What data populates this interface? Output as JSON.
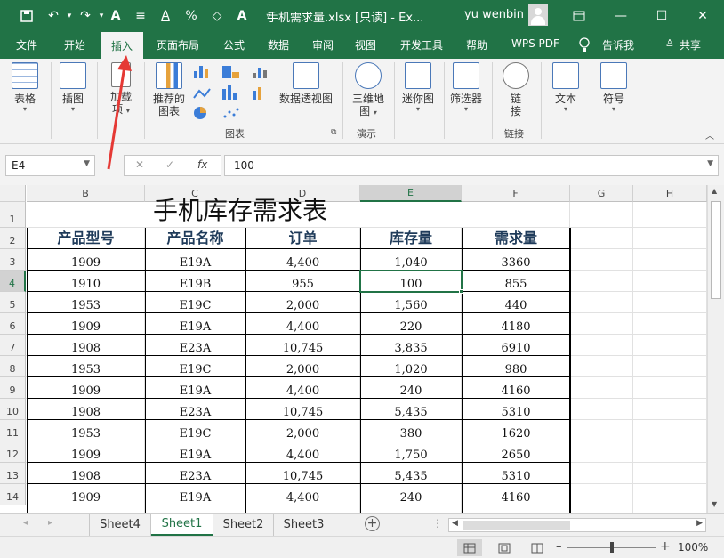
{
  "titlebar": {
    "doc_title": "手机需求量.xlsx [只读] - Ex...",
    "user_name": "yu wenbin"
  },
  "tabs": [
    "文件",
    "开始",
    "插入",
    "页面布局",
    "公式",
    "数据",
    "审阅",
    "视图",
    "开发工具",
    "帮助",
    "WPS PDF",
    "告诉我",
    "共享"
  ],
  "ribbon": {
    "table": "表格",
    "illustrations": "插图",
    "addins_1": "加载",
    "addins_2": "项",
    "recommended_1": "推荐的",
    "recommended_2": "图表",
    "pivot_chart": "数据透视图",
    "map_1": "三维地",
    "map_2": "图",
    "sparkline": "迷你图",
    "filter": "筛选器",
    "link_1": "链",
    "link_2": "接",
    "text": "文本",
    "symbol": "符号",
    "group_charts": "图表",
    "group_tours": "演示",
    "group_links": "链接"
  },
  "formula_bar": {
    "name_box": "E4",
    "formula": "100"
  },
  "grid": {
    "col_headers": [
      "B",
      "C",
      "D",
      "E",
      "F",
      "G",
      "H"
    ],
    "row_headers": [
      "1",
      "2",
      "3",
      "4",
      "5",
      "6",
      "7",
      "8",
      "9",
      "10",
      "11",
      "12",
      "13",
      "14"
    ],
    "title": "手机库存需求表",
    "headers": [
      "产品型号",
      "产品名称",
      "订单",
      "库存量",
      "需求量"
    ],
    "rows": [
      [
        "1909",
        "E19A",
        "4,400",
        "1,040",
        "3360"
      ],
      [
        "1910",
        "E19B",
        "955",
        "100",
        "855"
      ],
      [
        "1953",
        "E19C",
        "2,000",
        "1,560",
        "440"
      ],
      [
        "1909",
        "E19A",
        "4,400",
        "220",
        "4180"
      ],
      [
        "1908",
        "E23A",
        "10,745",
        "3,835",
        "6910"
      ],
      [
        "1953",
        "E19C",
        "2,000",
        "1,020",
        "980"
      ],
      [
        "1909",
        "E19A",
        "4,400",
        "240",
        "4160"
      ],
      [
        "1908",
        "E23A",
        "10,745",
        "5,435",
        "5310"
      ],
      [
        "1953",
        "E19C",
        "2,000",
        "380",
        "1620"
      ],
      [
        "1909",
        "E19A",
        "4,400",
        "1,750",
        "2650"
      ],
      [
        "1908",
        "E23A",
        "10,745",
        "5,435",
        "5310"
      ],
      [
        "1909",
        "E19A",
        "4,400",
        "240",
        "4160"
      ]
    ]
  },
  "sheets": [
    "Sheet4",
    "Sheet1",
    "Sheet2",
    "Sheet3"
  ],
  "active_sheet": "Sheet1",
  "status": {
    "zoom": "100%"
  },
  "colors": {
    "accent": "#217346",
    "annotation": "#e53935"
  }
}
